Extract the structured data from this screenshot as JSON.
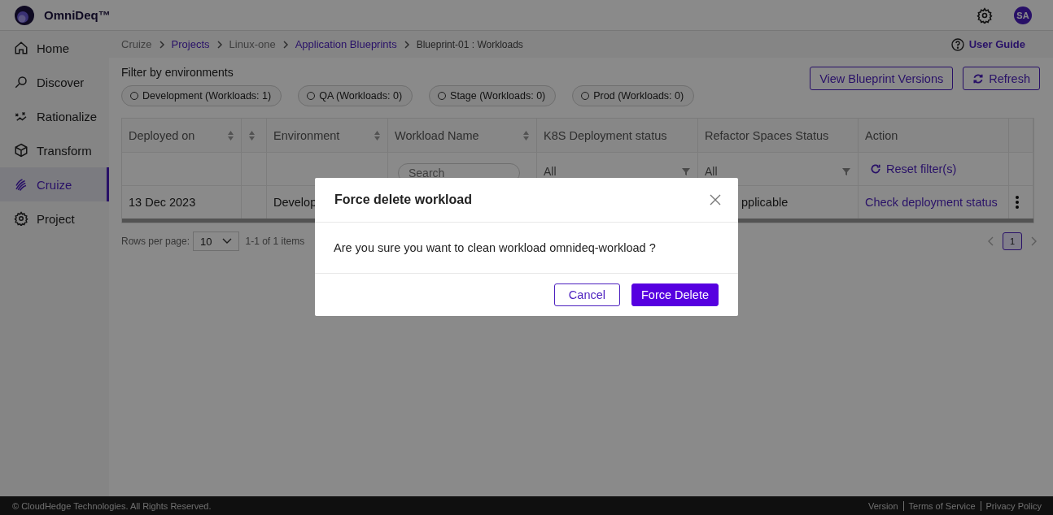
{
  "header": {
    "brand": "OmniDeq™",
    "avatar": "SA"
  },
  "sidebar": {
    "items": [
      {
        "label": "Home",
        "selected": false
      },
      {
        "label": "Discover",
        "selected": false
      },
      {
        "label": "Rationalize",
        "selected": false
      },
      {
        "label": "Transform",
        "selected": false
      },
      {
        "label": "Cruize",
        "selected": true
      },
      {
        "label": "Project",
        "selected": false
      }
    ]
  },
  "breadcrumbs": [
    {
      "label": "Cruize",
      "link": false
    },
    {
      "label": "Projects",
      "link": true
    },
    {
      "label": "Linux-one",
      "link": false
    },
    {
      "label": "Application Blueprints",
      "link": true
    },
    {
      "label": "Blueprint-01 : Workloads",
      "link": false
    }
  ],
  "user_guide": "User Guide",
  "filter_label": "Filter by environments",
  "filter_chips": [
    {
      "label": "Development (Workloads: 1)",
      "selected": false
    },
    {
      "label": "QA (Workloads: 0)",
      "selected": false
    },
    {
      "label": "Stage (Workloads: 0)",
      "selected": false
    },
    {
      "label": "Prod (Workloads: 0)",
      "selected": false
    }
  ],
  "actions": [
    {
      "label": "View Blueprint Versions",
      "kind": "plain"
    },
    {
      "label": "Refresh",
      "kind": "refresh"
    }
  ],
  "table": {
    "columns": [
      {
        "label": "Deployed on",
        "sortable": true
      },
      {
        "sortable": true
      },
      {
        "label": "Environment",
        "sortable": true
      },
      {
        "label": "Workload Name",
        "sortable": true
      },
      {
        "label": "K8S Deployment status",
        "sortable": false
      },
      {
        "label": "Refactor Spaces Status",
        "sortable": false
      },
      {
        "label": "Action",
        "sortable": false
      },
      {
        "sortable": false
      }
    ],
    "filters": [
      {
        "kind": "empty"
      },
      {
        "kind": "empty"
      },
      {
        "kind": "empty"
      },
      {
        "kind": "search",
        "placeholder": "Search"
      },
      {
        "kind": "select",
        "value": "All"
      },
      {
        "kind": "select",
        "value": "All"
      },
      {
        "kind": "reset",
        "label": "Reset filter(s)"
      },
      {
        "kind": "empty"
      }
    ],
    "rows": [
      {
        "cells": [
          {
            "kind": "text",
            "text": "13 Dec 2023"
          },
          {
            "kind": "empty"
          },
          {
            "kind": "text",
            "text": "Develop"
          },
          {
            "kind": "empty"
          },
          {
            "kind": "empty"
          },
          {
            "kind": "cut",
            "text": "pplicable"
          },
          {
            "kind": "link",
            "text": "Check deployment status"
          },
          {
            "kind": "menu"
          }
        ]
      }
    ]
  },
  "pagination": {
    "rows_label": "Rows per page:",
    "rows_value": "10",
    "range": "1-1 of 1 items",
    "pages": [
      {
        "label": "1",
        "selected": true
      }
    ]
  },
  "modal": {
    "title": "Force delete workload",
    "message": "Are you sure you want to clean workload omnideq-workload ?",
    "buttons": [
      {
        "label": "Cancel",
        "kind": "secondary"
      },
      {
        "label": "Force Delete",
        "kind": "primary"
      }
    ]
  },
  "footer": {
    "copyright": "© CloudHedge Technologies. All Rights Reserved.",
    "links": [
      "Version",
      "Terms of Service",
      "Privacy Policy"
    ]
  }
}
